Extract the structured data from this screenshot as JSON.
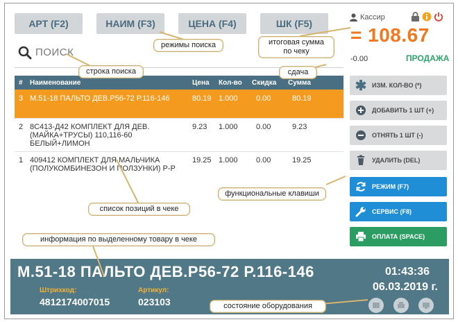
{
  "modes": [
    "АРТ (F2)",
    "НАИМ (F3)",
    "ЦЕНА (F4)",
    "ШК (F5)"
  ],
  "search": {
    "placeholder": "ПОИСК"
  },
  "user": {
    "name": "Кассир"
  },
  "total": "= 108.67",
  "change": "-0.00",
  "sale_label": "ПРОДАЖА",
  "table": {
    "headers": [
      "#",
      "Наименование",
      "Цена",
      "Кол-во",
      "Скидка",
      "Сумма"
    ],
    "rows": [
      {
        "num": "3",
        "name": "М.51-18 ПАЛЬТО ДЕВ.Р56-72 Р.116-146",
        "price": "80.19",
        "qty": "1.000",
        "disc": "0.00",
        "sum": "80.19"
      },
      {
        "num": "2",
        "name": "8С413-Д42 КОМПЛЕКТ ДЛЯ ДЕВ. (МАЙКА+ТРУСЫ) 110,116-60 БЕЛЫЙ+ЛИМОН",
        "price": "9.23",
        "qty": "1.000",
        "disc": "0.00",
        "sum": "9.23"
      },
      {
        "num": "1",
        "name": "409412 КОМПЛЕКТ ДЛЯ МАЛЬЧИКА (ПОЛУКОМБИНЕЗОН И ПОЛЗУНКИ) Р-Р",
        "price": "19.25",
        "qty": "1.000",
        "disc": "0.00",
        "sum": "19.25"
      }
    ]
  },
  "functions": [
    {
      "label": "ИЗМ. КОЛ-ВО (*)",
      "icon": "asterisk-icon"
    },
    {
      "label": "ДОБАВИТЬ 1 ШТ (+)",
      "icon": "plus-circle-icon"
    },
    {
      "label": "ОТНЯТЬ 1 ШТ (-)",
      "icon": "minus-circle-icon"
    },
    {
      "label": "УДАЛИТЬ (DEL)",
      "icon": "trash-icon"
    },
    {
      "label": "РЕЖИМ (F7)",
      "icon": "refresh-icon"
    },
    {
      "label": "СЕРВИС (F8)",
      "icon": "wrench-icon"
    },
    {
      "label": "ОПЛАТА (SPACE)",
      "icon": "printer-icon"
    }
  ],
  "bottom": {
    "title": "М.51-18 ПАЛЬТО ДЕВ.Р56-72 Р.116-146",
    "barcode_label": "Штрихкод:",
    "barcode": "4812174007015",
    "article_label": "Артикул:",
    "article": "023103",
    "time": "01:43:36",
    "date": "06.03.2019 г."
  },
  "callouts": {
    "search_modes": "режимы поиска",
    "total": "итоговая сумма по чеку",
    "search_line": "строка поиска",
    "change": "сдача",
    "function_keys": "функциональные клавиши",
    "items_list": "список позиций в чеке",
    "item_info": "информация по выделенному товару в чеке",
    "equipment": "состояние оборудования"
  },
  "colors": {
    "accent": "#f0781e",
    "selected": "#f49b1f",
    "header": "#4a6f82",
    "blue": "#1f8ed6",
    "green": "#2b9d62",
    "bottom": "#517887"
  }
}
